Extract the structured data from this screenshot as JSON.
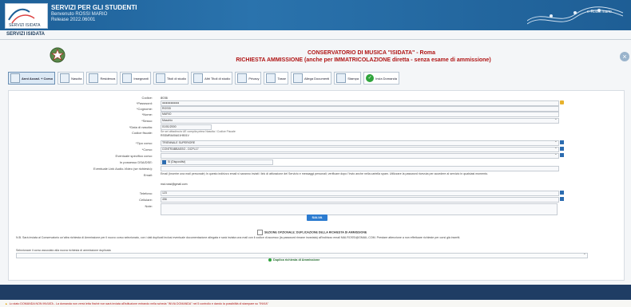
{
  "header": {
    "logo_text": "SERVIZI ISIDATA",
    "title": "SERVIZI PER GLI STUDENTI",
    "welcome": "Benvenuto ROSSI MARIO",
    "release": "Release 2022.06001",
    "user_link": "e-Rossi mario",
    "brand_color": "#1d5f97"
  },
  "tab_label": "SERVIZI ISIDATA",
  "page": {
    "conservatory": "CONSERVATORIO DI MUSICA \"ISIDATA\" - Roma",
    "request_title": "RICHIESTA AMMISSIONE (anche per IMMATRICOLAZIONE diretta - senza esame di ammissione)",
    "close_icon": "close-icon"
  },
  "nav": [
    {
      "label": "Anni Accad. + Corso",
      "icon": "user-icon",
      "active": true
    },
    {
      "label": "Nascita",
      "icon": "calendar-icon"
    },
    {
      "label": "Residenza",
      "icon": "home-icon"
    },
    {
      "label": "Insegnanti",
      "icon": "teacher-icon"
    },
    {
      "label": "Titoli di studio",
      "icon": "diploma-icon"
    },
    {
      "label": "Altri Titoli di studio",
      "icon": "diploma-icon"
    },
    {
      "label": "Privacy",
      "icon": "lock-icon"
    },
    {
      "label": "Tasse",
      "icon": "money-icon"
    },
    {
      "label": "Allega Documenti",
      "icon": "attach-icon"
    },
    {
      "label": "Stampa",
      "icon": "print-icon"
    },
    {
      "label": "Invia Domanda",
      "icon": "check-icon"
    }
  ],
  "form": {
    "codice": {
      "label": "Codice:",
      "value": "8036"
    },
    "password": {
      "label": "*Password:",
      "value": "●●●●●●●●●●"
    },
    "cognome": {
      "label": "*Cognome:",
      "value": "ROSSI"
    },
    "nome": {
      "label": "*Nome:",
      "value": "MARIO"
    },
    "sesso": {
      "label": "*Sesso:",
      "value": "Maschio"
    },
    "data_nascita": {
      "label": "*Data di nascita:",
      "value": "01/01/2000"
    },
    "codice_fiscale": {
      "label": "Codice fiscale:",
      "hint": "Se sei cittadino/a UE compila prima Nascita / Codice Fiscale",
      "value": "RSSMRA00A01H501V"
    },
    "tipo_corso": {
      "label": "*Tipo corso:",
      "value": "TRIENNALE SUPERIORE"
    },
    "corso": {
      "label": "*Corso:",
      "value": "CONTRABBASSO - DCPL17"
    },
    "eventuale_specifico": {
      "label": "Eventuale specifico corso:",
      "value": ""
    },
    "possesso_dsa": {
      "label": "In possesso DSA/DSE:",
      "value": "Si (Dispositivi)"
    },
    "link_audio_video": {
      "label": "Eventuale Link Audio-Video (se richiesto):",
      "value": ""
    },
    "email": {
      "label": "Email:",
      "note": "Email (Inserire una mail personale) In questo indirizzo email vi saranno inviati i link di attivazione del Servizio e messaggi personali; verificare dopo l'invio anche nella cartella spam. Utilizzare la password ricevuta per accedere al servizio in qualsiasi momento.",
      "value": "mai.rossi@gmail.com"
    },
    "telefono": {
      "label": "Telefono:",
      "value": "123"
    },
    "cellulare": {
      "label": "Cellulare:",
      "value": "456"
    },
    "note": {
      "label": "Note:",
      "value": ""
    }
  },
  "save_label": "SALVA",
  "duplicate": {
    "title": "SEZIONE OPZIONALE: DUPLICAZIONE DELLA RICHIESTA DI AMMISSIONE",
    "text": "N.B. Sarà inviata al Conservatorio un'altra richiesta di Ammissione per il nuovo corso selezionato, con i dati duplicati inclusi eventuale documentazione allegata e sarà inviata una mail con il codice di accesso (la password rimane invariata) all'indirizzo email MAI.ROSSI@GMAIL.COM. Prestare attenzione a non effettuare richieste per corsi già inseriti.",
    "select_label": "Selezionare il corso associato alla nuova richiesta di ammissione duplicata",
    "link": "Duplica richiesta di Ammissione"
  },
  "warning": "Lo stato DOMANDA NON INVIATA - La domanda non verrà letta finché non sarà inviata all'istituzione entrando nella scheda \"INVIA DOMANDA\" nel 5 controllo e dando la possibilità di stampare su \"INVIA\""
}
